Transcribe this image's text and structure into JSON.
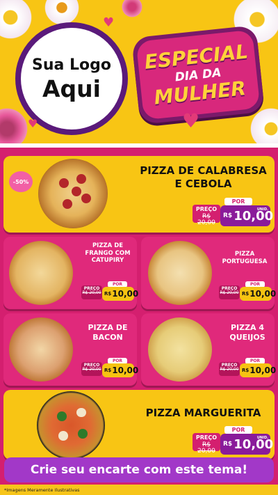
{
  "header": {
    "logo_line1": "Sua Logo",
    "logo_line2": "Aqui",
    "badge_line1": "ESPECIAL",
    "badge_line2": "DIA DA",
    "badge_line3": "MULHER"
  },
  "featured": [
    {
      "name_line1": "PIZZA DE CALABRESA",
      "name_line2": "E CEBOLA",
      "discount": "-50%",
      "por": "POR",
      "old_label": "PREÇO",
      "old_price": "R$ 20,00",
      "currency": "R$",
      "new_price": "10,00",
      "unit": "UNID."
    },
    {
      "name_line1": "PIZZA MARGUERITA",
      "por": "POR",
      "old_label": "PREÇO",
      "old_price": "R$ 20,00",
      "currency": "R$",
      "new_price": "10,00",
      "unit": "UNID."
    }
  ],
  "grid": [
    {
      "name": "PIZZA DE FRANGO COM CATUPIRY",
      "por": "POR",
      "old_label": "PREÇO",
      "old_price": "R$ 20,00",
      "currency": "R$",
      "new_price": "10,00"
    },
    {
      "name": "PIZZA PORTUGUESA",
      "por": "POR",
      "old_label": "PREÇO",
      "old_price": "R$ 20,00",
      "currency": "R$",
      "new_price": "10,00"
    },
    {
      "name": "PIZZA DE BACON",
      "por": "POR",
      "old_label": "PREÇO",
      "old_price": "R$ 20,00",
      "currency": "R$",
      "new_price": "10,00"
    },
    {
      "name": "PIZZA 4 QUEIJOS",
      "por": "POR",
      "old_label": "PREÇO",
      "old_price": "R$ 20,00",
      "currency": "R$",
      "new_price": "10,00"
    }
  ],
  "cta": "Crie seu encarte com este tema!",
  "footer": "*Imagens Meramente Ilustrativas",
  "colors": {
    "yellow": "#f8c514",
    "pink": "#d41f6f",
    "purple": "#8a1b9a",
    "cta": "#a238c8"
  }
}
